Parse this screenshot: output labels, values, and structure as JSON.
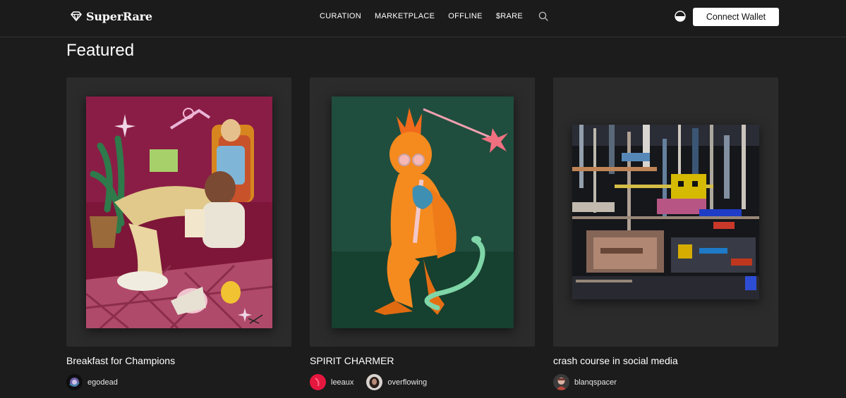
{
  "header": {
    "brand": "SuperRare",
    "nav": [
      {
        "label": "CURATION"
      },
      {
        "label": "MARKETPLACE"
      },
      {
        "label": "OFFLINE"
      },
      {
        "label": "$RARE"
      }
    ],
    "search_icon": "search-icon",
    "theme_icon": "half-circle-theme-icon",
    "connect_label": "Connect Wallet"
  },
  "section": {
    "title": "Featured"
  },
  "cards": [
    {
      "title": "Breakfast for Champions",
      "creators": [
        {
          "name": "egodead"
        }
      ]
    },
    {
      "title": "SPIRIT CHARMER",
      "creators": [
        {
          "name": "leeaux"
        },
        {
          "name": "overflowing"
        }
      ]
    },
    {
      "title": "crash course in social media",
      "creators": [
        {
          "name": "blanqspacer"
        }
      ]
    }
  ],
  "colors": {
    "background": "#1c1c1c",
    "card": "#2b2b2b",
    "button": "#ffffff"
  }
}
